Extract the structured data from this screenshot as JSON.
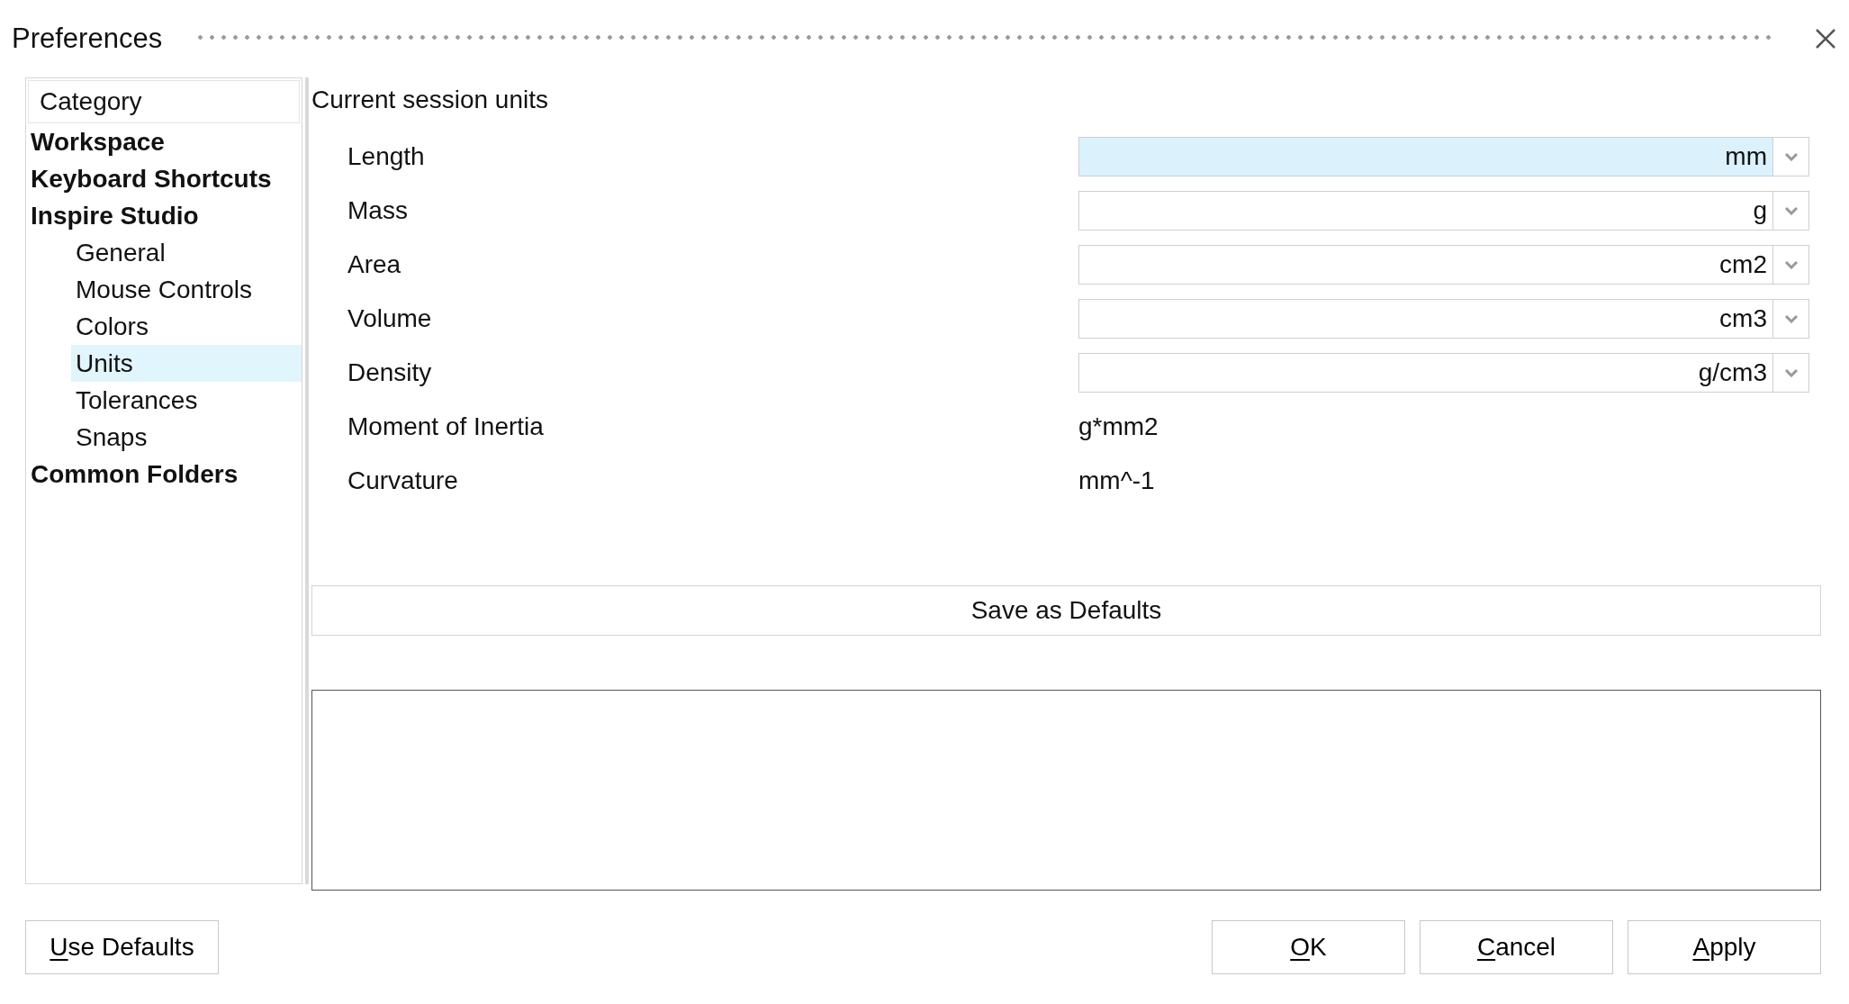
{
  "window": {
    "title": "Preferences"
  },
  "sidebar": {
    "header": "Category",
    "items": [
      {
        "label": "Workspace",
        "selected": false
      },
      {
        "label": "Keyboard Shortcuts",
        "selected": false
      },
      {
        "label": "Inspire Studio",
        "selected": false,
        "children": [
          {
            "label": "General",
            "selected": false
          },
          {
            "label": "Mouse Controls",
            "selected": false
          },
          {
            "label": "Colors",
            "selected": false
          },
          {
            "label": "Units",
            "selected": true
          },
          {
            "label": "Tolerances",
            "selected": false
          },
          {
            "label": "Snaps",
            "selected": false
          }
        ]
      },
      {
        "label": "Common Folders",
        "selected": false
      }
    ]
  },
  "section_title": "Current session units",
  "units": [
    {
      "kind": "dropdown",
      "label": "Length",
      "value": "mm",
      "highlighted": true
    },
    {
      "kind": "dropdown",
      "label": "Mass",
      "value": "g",
      "highlighted": false
    },
    {
      "kind": "dropdown",
      "label": "Area",
      "value": "cm2",
      "highlighted": false
    },
    {
      "kind": "dropdown",
      "label": "Volume",
      "value": "cm3",
      "highlighted": false
    },
    {
      "kind": "dropdown",
      "label": "Density",
      "value": "g/cm3",
      "highlighted": false
    },
    {
      "kind": "text",
      "label": "Moment of Inertia",
      "value": "g*mm2"
    },
    {
      "kind": "text",
      "label": "Curvature",
      "value": "mm^-1"
    }
  ],
  "save_button": "Save as Defaults",
  "buttons_left": [
    {
      "mnemonic": "U",
      "rest": "se Defaults"
    }
  ],
  "buttons_right": [
    {
      "mnemonic": "O",
      "rest": "K"
    },
    {
      "mnemonic": "C",
      "rest": "ancel"
    },
    {
      "mnemonic": "A",
      "rest": "pply"
    }
  ]
}
